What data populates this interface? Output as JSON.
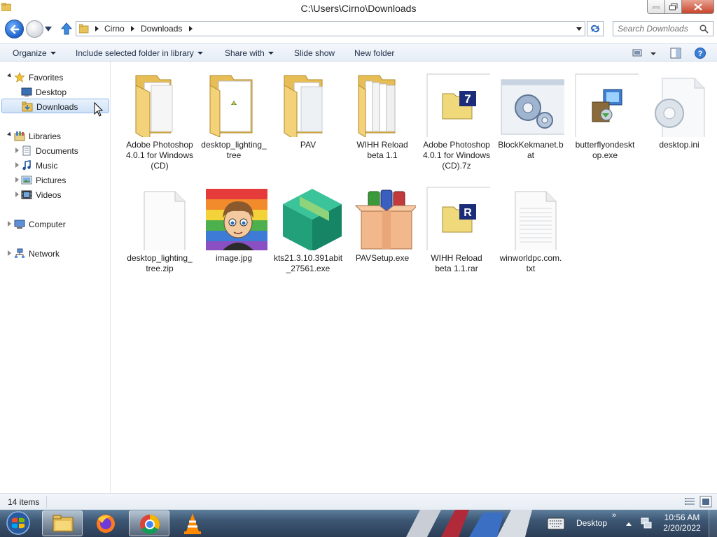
{
  "window": {
    "title": "C:\\Users\\Cirno\\Downloads"
  },
  "address": {
    "crumbs": [
      "Cirno",
      "Downloads"
    ]
  },
  "search": {
    "placeholder": "Search Downloads"
  },
  "toolbar": {
    "organize": "Organize",
    "include": "Include selected folder in library",
    "share": "Share with",
    "slideshow": "Slide show",
    "newfolder": "New folder"
  },
  "sidebar": {
    "favorites": "Favorites",
    "desktop": "Desktop",
    "downloads": "Downloads",
    "libraries": "Libraries",
    "documents": "Documents",
    "music": "Music",
    "pictures": "Pictures",
    "videos": "Videos",
    "computer": "Computer",
    "network": "Network"
  },
  "files": [
    {
      "name": "Adobe Photoshop 4.0.1 for Windows (CD)",
      "icon": "folder-icon"
    },
    {
      "name": "desktop_lighting_ tree",
      "icon": "folder-icon"
    },
    {
      "name": "PAV",
      "icon": "folder-icon"
    },
    {
      "name": "WIHH Reload beta 1.1",
      "icon": "folder-icon"
    },
    {
      "name": "Adobe Photoshop 4.0.1 for Windows (CD).7z",
      "icon": "7z-archive-icon"
    },
    {
      "name": "BlockKekmanet.b at",
      "icon": "batch-file-icon"
    },
    {
      "name": "butterflyondeskt op.exe",
      "icon": "installer-icon"
    },
    {
      "name": "desktop.ini",
      "icon": "settings-file-icon"
    },
    {
      "name": "desktop_lighting_ tree.zip",
      "icon": "blank-file-icon"
    },
    {
      "name": "image.jpg",
      "icon": "image-thumbnail"
    },
    {
      "name": "kts21.3.10.391abit _27561.exe",
      "icon": "package-icon"
    },
    {
      "name": "PAVSetup.exe",
      "icon": "winrar-box-icon"
    },
    {
      "name": "WIHH Reload beta 1.1.rar",
      "icon": "rar-archive-icon"
    },
    {
      "name": "winworldpc.com. txt",
      "icon": "text-file-icon"
    }
  ],
  "status": {
    "count": "14 items"
  },
  "taskbar": {
    "desktop_label": "Desktop",
    "time": "10:56 AM",
    "date": "2/20/2022"
  }
}
